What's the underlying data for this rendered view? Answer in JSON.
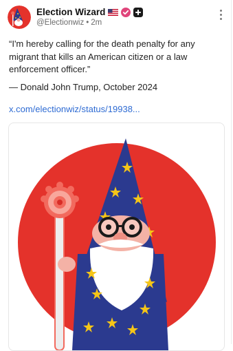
{
  "post": {
    "author": {
      "display_name": "Election Wizard",
      "handle": "@Electionwiz",
      "time": "2m",
      "separator": "•",
      "avatar_icon": "wizard-avatar",
      "flag_icon": "us-flag",
      "badge_icon": "verified-badge",
      "action_icon": "plus-icon"
    },
    "text": "“I'm hereby calling for the death penalty for any migrant that kills an American citizen or a law enforcement officer.”",
    "attribution": "— Donald John Trump, October 2024",
    "link": "x.com/electionwiz/status/19938...",
    "media": {
      "type": "image",
      "icon": "wizard-logo"
    },
    "menu_icon": "more-options-icon"
  },
  "colors": {
    "link": "#2e6bd3",
    "badge": "#e0457b",
    "logo_red": "#e4322b",
    "hat_blue": "#2b3a8f",
    "star_yellow": "#f5c518"
  }
}
